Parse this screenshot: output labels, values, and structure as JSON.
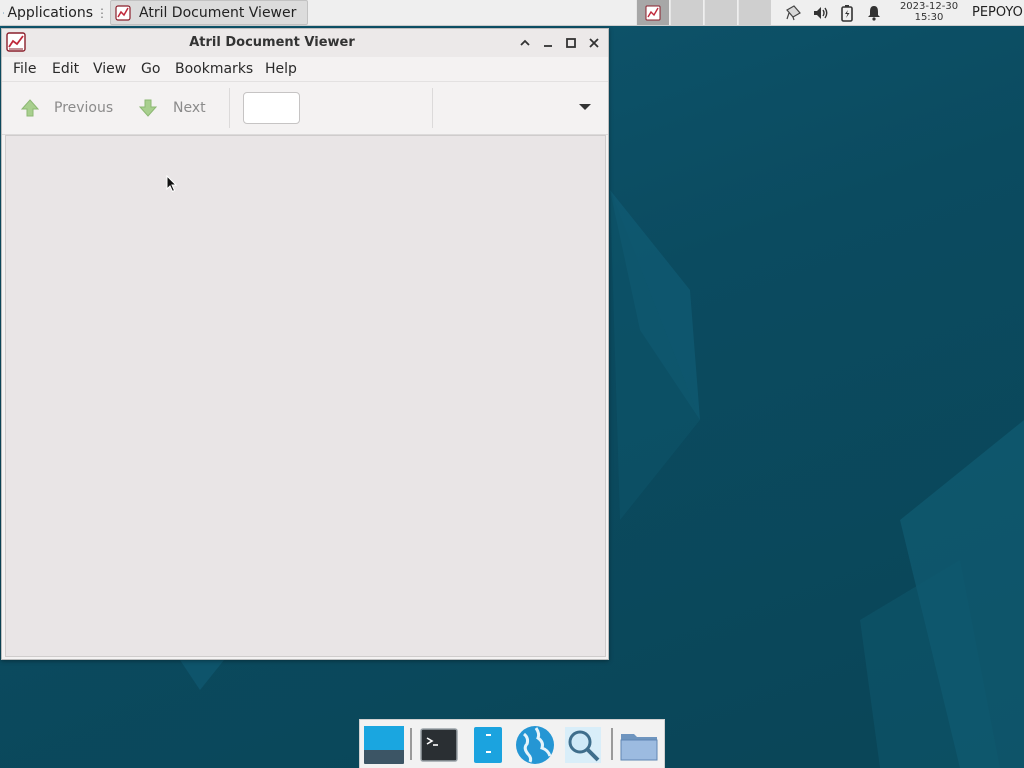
{
  "top_panel": {
    "applications_label": "Applications",
    "task_title": "Atril Document Viewer",
    "clock_date": "2023-12-30",
    "clock_time": "15:30",
    "user": "PEPOYO",
    "tray_icons": [
      "network-icon",
      "volume-icon",
      "battery-icon",
      "notification-bell-icon"
    ]
  },
  "window": {
    "title": "Atril Document Viewer",
    "menus": [
      "File",
      "Edit",
      "View",
      "Go",
      "Bookmarks",
      "Help"
    ],
    "toolbar": {
      "previous_label": "Previous",
      "next_label": "Next",
      "page_entry_value": ""
    }
  },
  "dock": {
    "items": [
      "show-desktop-icon",
      "terminal-icon",
      "file-manager-icon",
      "web-browser-icon",
      "app-finder-icon",
      "folder-icon"
    ]
  },
  "colors": {
    "desktop": "#0d4a5e",
    "panel": "#efefef",
    "window_bg": "#f4f2f2",
    "document_area": "#e9e5e6"
  }
}
